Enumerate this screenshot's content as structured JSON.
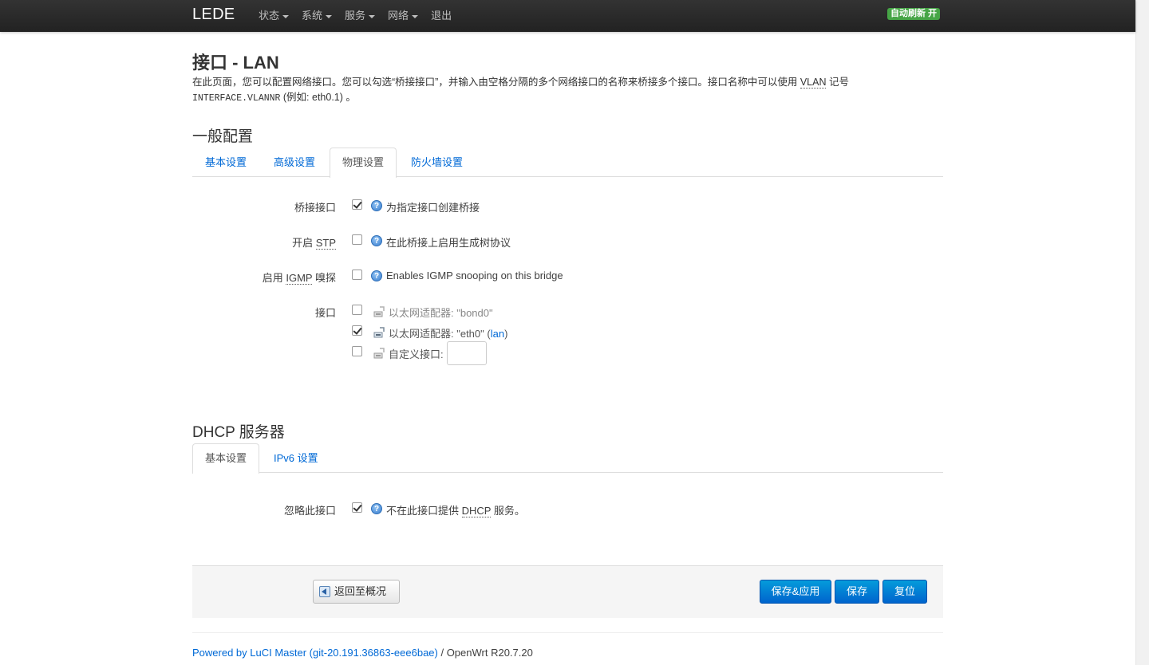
{
  "navbar": {
    "brand": "LEDE",
    "menu": [
      {
        "label": "状态",
        "dropdown": true
      },
      {
        "label": "系统",
        "dropdown": true
      },
      {
        "label": "服务",
        "dropdown": true
      },
      {
        "label": "网络",
        "dropdown": true
      },
      {
        "label": "退出",
        "dropdown": false
      }
    ],
    "auto_refresh": "自动刷新 开"
  },
  "page": {
    "title": "接口 - LAN",
    "desc_part1": "在此页面，您可以配置网络接口。您可以勾选“桥接接口”，并输入由空格分隔的多个网络接口的名称来桥接多个接口。接口名称中可以使用 ",
    "desc_vlan": "VLAN",
    "desc_part2": " 记号",
    "desc_mono": "INTERFACE.VLANNR",
    "desc_part3": " (例如: eth0.1) 。"
  },
  "general": {
    "heading": "一般配置",
    "tabs": [
      {
        "label": "基本设置",
        "active": false
      },
      {
        "label": "高级设置",
        "active": false
      },
      {
        "label": "物理设置",
        "active": true
      },
      {
        "label": "防火墙设置",
        "active": false
      }
    ],
    "bridge": {
      "label": "桥接接口",
      "checked": true,
      "help": "为指定接口创建桥接"
    },
    "stp": {
      "label_prefix": "开启 ",
      "label_abbr": "STP",
      "checked": false,
      "help": "在此桥接上启用生成树协议"
    },
    "igmp": {
      "label_prefix": "启用 ",
      "label_abbr": "IGMP",
      "label_suffix": " 嗅探",
      "checked": false,
      "help": "Enables IGMP snooping on this bridge"
    },
    "interfaces": {
      "label": "接口",
      "items": [
        {
          "text": "以太网适配器: \"bond0\"",
          "checked": false,
          "dim": true,
          "network": ""
        },
        {
          "text": "以太网适配器: \"eth0\"",
          "checked": true,
          "dim": false,
          "network": "lan"
        }
      ],
      "custom_label": "自定义接口:",
      "custom_value": ""
    }
  },
  "dhcp": {
    "heading": "DHCP 服务器",
    "tabs": [
      {
        "label": "基本设置",
        "active": true
      },
      {
        "label": "IPv6 设置",
        "active": false
      }
    ],
    "ignore": {
      "label": "忽略此接口",
      "checked": true,
      "help_prefix": "不在此接口提供 ",
      "help_abbr": "DHCP",
      "help_suffix": " 服务。"
    }
  },
  "actions": {
    "back": "返回至概况",
    "save_apply": "保存&应用",
    "save": "保存",
    "reset": "复位"
  },
  "footer": {
    "link": "Powered by LuCI Master (git-20.191.36863-eee6bae)",
    "version": " / OpenWrt R20.7.20"
  },
  "colors": {
    "navbar": "#222222",
    "link": "#0069d6",
    "primary": "#0064cd",
    "badge": "#46a546"
  }
}
